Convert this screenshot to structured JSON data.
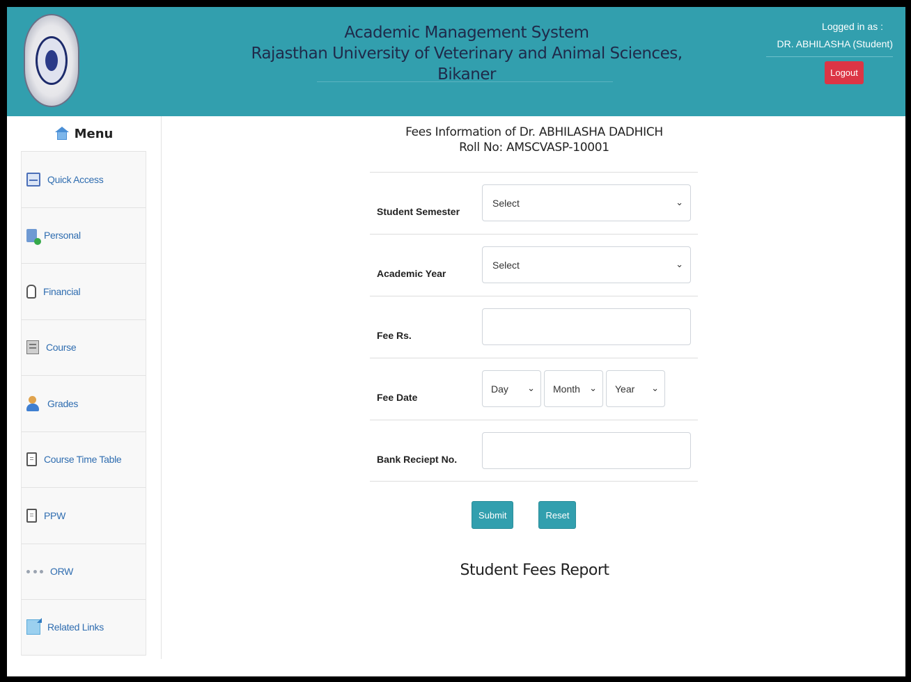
{
  "header": {
    "title_line1": "Academic Management System",
    "title_line2": "Rajasthan University of Veterinary and Animal Sciences, Bikaner",
    "logged_in_label": "Logged in as :",
    "logged_in_user": "DR. ABHILASHA (Student)",
    "logout_label": "Logout",
    "accent_color": "#329fae",
    "logout_color": "#dc3545"
  },
  "sidebar": {
    "menu_label": "Menu",
    "items": [
      {
        "label": "Quick Access",
        "icon": "quick-access-icon"
      },
      {
        "label": "Personal",
        "icon": "personal-icon"
      },
      {
        "label": "Financial",
        "icon": "financial-icon"
      },
      {
        "label": "Course",
        "icon": "course-icon"
      },
      {
        "label": "Grades",
        "icon": "grades-icon"
      },
      {
        "label": "Course Time Table",
        "icon": "timetable-icon"
      },
      {
        "label": "PPW",
        "icon": "ppw-icon"
      },
      {
        "label": "ORW",
        "icon": "orw-icon"
      },
      {
        "label": "Related Links",
        "icon": "related-links-icon"
      }
    ]
  },
  "main": {
    "title_line1": "Fees Information of Dr. ABHILASHA DADHICH",
    "title_line2": "Roll No: AMSCVASP-10001",
    "form": {
      "semester_label": "Student Semester",
      "semester_value": "Select",
      "year_label": "Academic Year",
      "year_value": "Select",
      "fee_label": "Fee Rs.",
      "fee_value": "",
      "date_label": "Fee Date",
      "day_value": "Day",
      "month_value": "Month",
      "year_select_value": "Year",
      "receipt_label": "Bank Reciept No.",
      "receipt_value": ""
    },
    "submit_label": "Submit",
    "reset_label": "Reset",
    "report_title": "Student Fees Report"
  }
}
